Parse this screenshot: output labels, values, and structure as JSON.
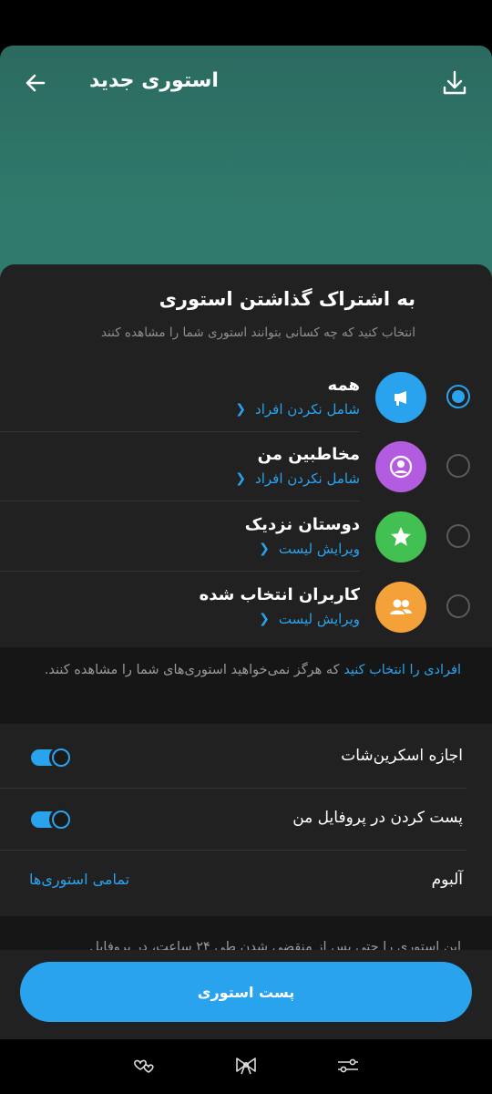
{
  "header": {
    "title": "استوری جدید",
    "back_icon": "arrow-left-icon",
    "download_icon": "download-icon"
  },
  "sheet": {
    "title": "به اشتراک گذاشتن استوری",
    "subtitle": "انتخاب کنید که چه کسانی بتوانند استوری شما را مشاهده کنند",
    "options": [
      {
        "name": "همه",
        "link": "شامل نکردن افراد",
        "icon": "megaphone-icon",
        "color": "#2aa3ee",
        "selected": true
      },
      {
        "name": "مخاطبین من",
        "link": "شامل نکردن افراد",
        "icon": "user-icon",
        "color": "#b45ce0",
        "selected": false
      },
      {
        "name": "دوستان نزدیک",
        "link": "ویرایش لیست",
        "icon": "star-icon",
        "color": "#42c152",
        "selected": false
      },
      {
        "name": "کاربران انتخاب شده",
        "link": "ویرایش لیست",
        "icon": "group-icon",
        "color": "#f5a13a",
        "selected": false
      }
    ],
    "exclude_link": "افرادی را انتخاب کنید",
    "exclude_rest": " که هرگز نمی‌خواهید استوری‌های شما را مشاهده کنند.",
    "settings": {
      "screenshot_label": "اجازه اسکرین‌شات",
      "screenshot_on": true,
      "profile_label": "پست کردن در پروفایل من",
      "profile_on": true,
      "album_label": "آلبوم",
      "album_value": "تمامی استوری‌ها"
    },
    "footer_note": "این استوری را حتی پس از منقضی شدن طی ۲۴ ساعت، در پروفایل",
    "post_button": "پست استوری"
  },
  "colors": {
    "accent": "#2aa3ee",
    "sheet_bg": "#212121",
    "preview_bg": "#2f7a6c"
  }
}
